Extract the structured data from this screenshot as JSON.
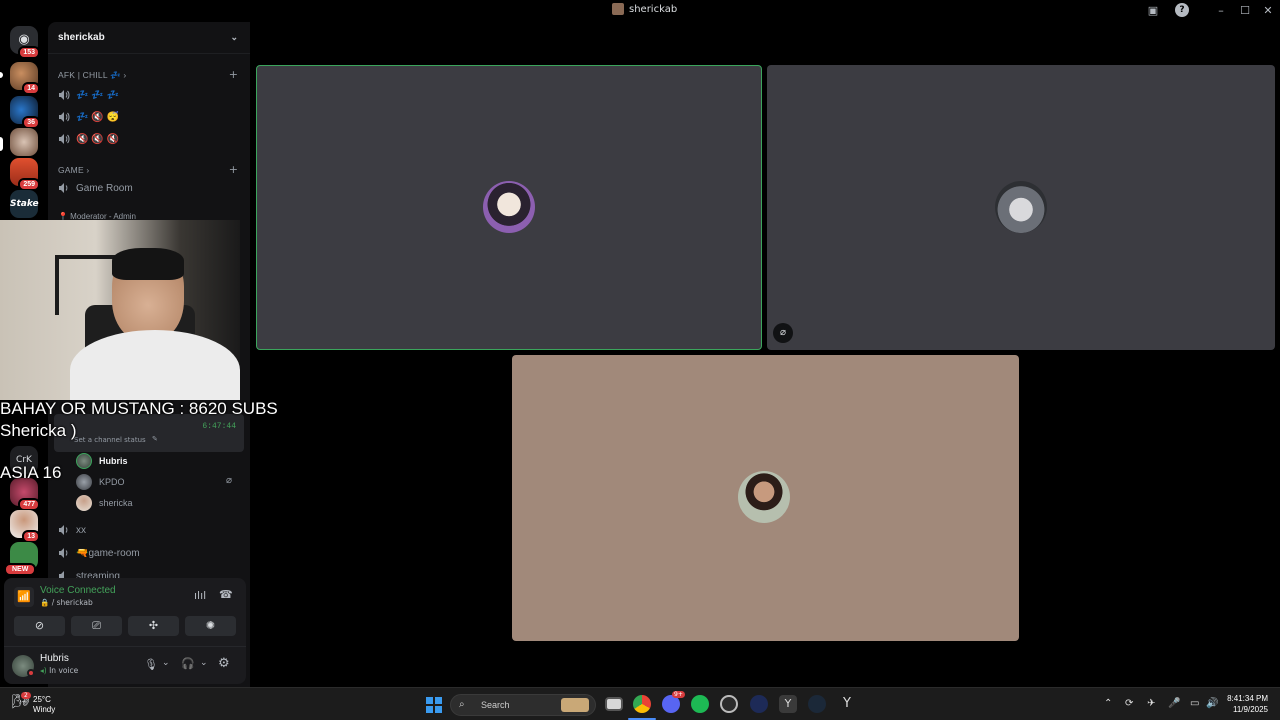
{
  "window": {
    "title": "sherickab"
  },
  "servers": [
    {
      "name": "discord-home",
      "badge": "153"
    },
    {
      "name": "server-1",
      "badge": "14"
    },
    {
      "name": "server-2",
      "badge": "36"
    },
    {
      "name": "server-3",
      "badge": ""
    },
    {
      "name": "server-4",
      "badge": "259"
    },
    {
      "name": "stake",
      "label": "Stake",
      "badge": ""
    },
    {
      "name": "crk",
      "label": "CrK",
      "badge": ""
    },
    {
      "name": "server-7",
      "badge": "477"
    },
    {
      "name": "server-8",
      "badge": "13"
    },
    {
      "name": "server-9",
      "badge": "NEW"
    }
  ],
  "sidebar": {
    "server_name": "sherickab",
    "categories": [
      {
        "label": "AFK | CHILL 💤",
        "channels": [
          "💤 💤 💤",
          "💤 🔇 😴",
          "🔇 🔇 🔇"
        ]
      },
      {
        "label": "GAME",
        "channels": [
          "Game Room"
        ]
      }
    ],
    "partial_channel": "📍 Moderator - Admin",
    "active_channel": {
      "status_time": "6:47:44",
      "status_prompt": "Set a channel status"
    },
    "voice_users": [
      "Hubris",
      "KPDO",
      "shericka"
    ],
    "more_channels": [
      "xx",
      "🔫game-room",
      "streaming"
    ]
  },
  "voice_panel": {
    "status": "Voice Connected",
    "sub": "🔒 / sherickab"
  },
  "user": {
    "name": "Hubris",
    "status": "In voice"
  },
  "overlay": {
    "line1": "BAHAY OR MUSTANG : 8620 SUBS",
    "line2": "Shericka )",
    "line3": "ASIA 16"
  },
  "taskbar": {
    "search_placeholder": "Search",
    "weather_temp": "25°C",
    "weather_desc": "Windy",
    "weather_badge": "2",
    "time": "8:41:34 PM",
    "date": "11/9/2025",
    "discord_badge": "9+"
  },
  "colors": {
    "speaking_border": "#3ba55c",
    "tile_dark": "#3c3c42",
    "tile_beige": "#a1897a",
    "accent_green": "#43a25a"
  }
}
